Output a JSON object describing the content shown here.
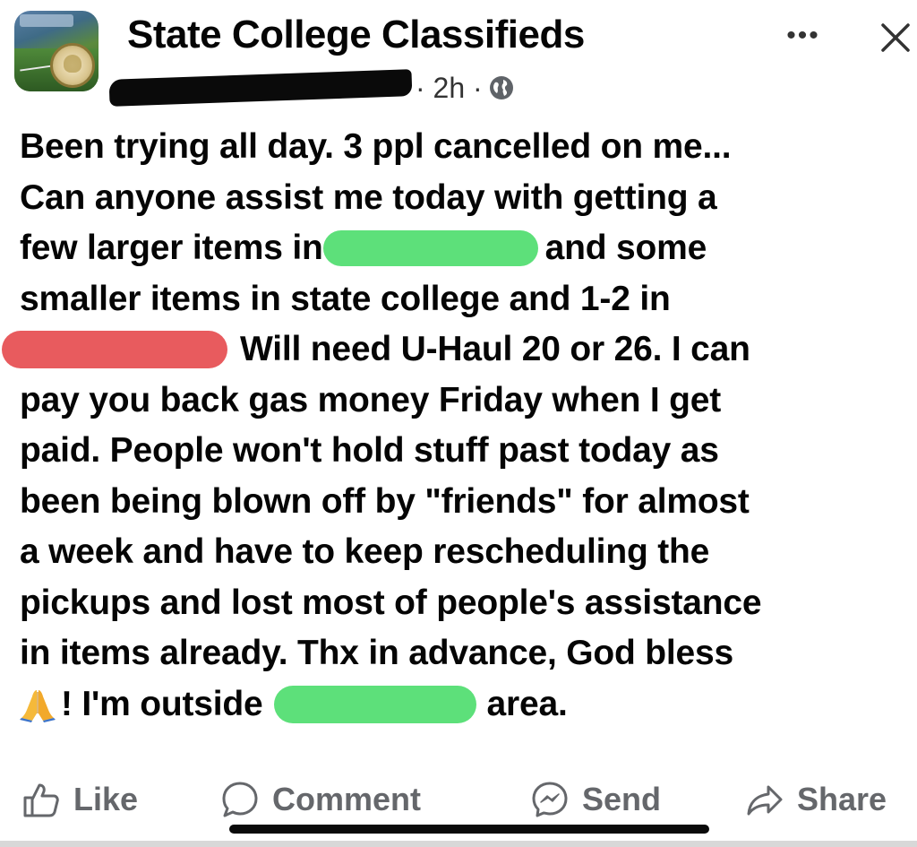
{
  "header": {
    "group_name": "State College Classifieds",
    "time": "· 2h ·",
    "more_label": "•••",
    "avatar_icon": "group-avatar-icon",
    "close_icon": "close-icon",
    "globe_icon": "globe-icon"
  },
  "post": {
    "lines": [
      {
        "a": "Been trying all day. 3 ppl cancelled on me..."
      },
      {
        "a": "Can anyone assist me today  with getting a"
      },
      {
        "a": "few larger items in",
        "b": "and some"
      },
      {
        "a": "smaller items in state college and 1-2 in"
      },
      {
        "b": "Will need  U-Haul 20 or 26.  I can"
      },
      {
        "a": "pay you back gas money Friday when I get"
      },
      {
        "a": "paid. People won't hold stuff past today as"
      },
      {
        "a": "been being blown off by \"friends\" for almost"
      },
      {
        "a": "a week and have to keep rescheduling the"
      },
      {
        "a": "pickups and lost most of people's assistance"
      },
      {
        "a": "in items already. Thx in advance, God bless"
      },
      {
        "a": "! I'm outside",
        "b": "area."
      }
    ],
    "emoji": "folded-hands-emoji",
    "redaction_colors": {
      "black": "#0a0a0a",
      "green": "#5de07a",
      "red": "#e85b5e"
    }
  },
  "actions": {
    "like": "Like",
    "comment": "Comment",
    "send": "Send",
    "share": "Share",
    "icons": [
      "thumbs-up-icon",
      "comment-bubble-icon",
      "messenger-icon",
      "share-arrow-icon"
    ],
    "color": "#65676b"
  }
}
